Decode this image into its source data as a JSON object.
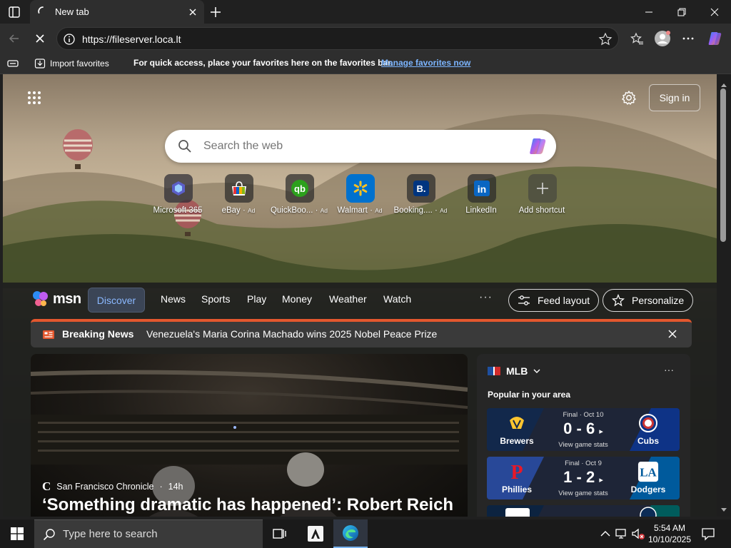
{
  "browser": {
    "tab_title": "New tab",
    "url": "https://fileserver.loca.lt"
  },
  "favorites_bar": {
    "import_label": "Import favorites",
    "message": "For quick access, place your favorites here on the favorites bar.",
    "manage_link": "Manage favorites now"
  },
  "newtab": {
    "sign_in": "Sign in",
    "search_placeholder": "Search the web",
    "shortcuts": [
      {
        "label": "Microsoft 365",
        "ad": "",
        "icon": "microsoft-365-icon",
        "color": "#5b5fc7"
      },
      {
        "label": "eBay",
        "ad": "Ad",
        "icon": "ebay-icon",
        "color": "#e53238"
      },
      {
        "label": "QuickBoo...",
        "ad": "Ad",
        "icon": "quickbooks-icon",
        "color": "#2ca01c"
      },
      {
        "label": "Walmart",
        "ad": "Ad",
        "icon": "walmart-icon",
        "color": "#0071ce"
      },
      {
        "label": "Booking....",
        "ad": "Ad",
        "icon": "booking-icon",
        "color": "#003580"
      },
      {
        "label": "LinkedIn",
        "ad": "",
        "icon": "linkedin-icon",
        "color": "#0a66c2"
      },
      {
        "label": "Add shortcut",
        "ad": "",
        "icon": "plus-icon",
        "color": "#555555"
      }
    ]
  },
  "msn": {
    "logo_text": "msn",
    "nav": [
      "Discover",
      "News",
      "Sports",
      "Play",
      "Money",
      "Weather",
      "Watch"
    ],
    "more": "···",
    "feed_layout": "Feed layout",
    "personalize": "Personalize",
    "breaking": {
      "label": "Breaking News",
      "headline": "Venezuela's Maria Corina Machado wins 2025 Nobel Peace Prize"
    },
    "hero": {
      "source": "San Francisco Chronicle",
      "age": "14h",
      "headline": "‘Something dramatic has happened’: Robert Reich"
    },
    "mlb": {
      "title": "MLB",
      "popular": "Popular in your area",
      "games": [
        {
          "status": "Final · Oct 10",
          "home": "Brewers",
          "away": "Cubs",
          "score": "0 - 6",
          "stats": "View game stats",
          "home_color": "#12284b",
          "away_color": "#0e3386"
        },
        {
          "status": "Final · Oct 9",
          "home": "Phillies",
          "away": "Dodgers",
          "score": "1 - 2",
          "stats": "View game stats",
          "home_color": "#284898",
          "away_color": "#005a9c"
        }
      ]
    }
  },
  "taskbar": {
    "search_placeholder": "Type here to search",
    "time": "5:54 AM",
    "date": "10/10/2025"
  },
  "colors": {
    "accent": "#7cb5ff",
    "breaking": "#e4572e"
  }
}
